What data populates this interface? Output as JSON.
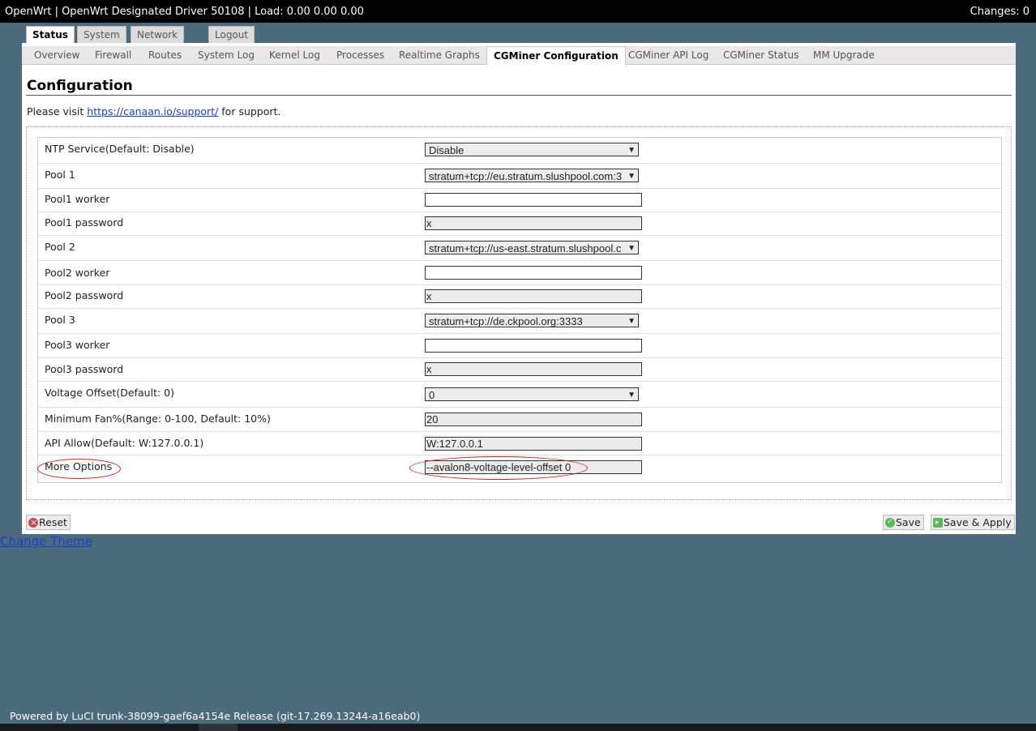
{
  "topbar": {
    "title": "OpenWrt | OpenWrt Designated Driver 50108 | Load: 0.00 0.00 0.00",
    "changes": "Changes: 0"
  },
  "main_tabs": [
    "Status",
    "System",
    "Network",
    "Logout"
  ],
  "sub_tabs": [
    "Overview",
    "Firewall",
    "Routes",
    "System Log",
    "Kernel Log",
    "Processes",
    "Realtime Graphs",
    "CGMiner Configuration",
    "CGMiner API Log",
    "CGMiner Status",
    "MM Upgrade"
  ],
  "page": {
    "heading": "Configuration",
    "visit_prefix": "Please visit",
    "visit_link": "https://canaan.io/support/",
    "visit_suffix": "for support."
  },
  "form": {
    "ntp": {
      "label": "NTP Service(Default: Disable)",
      "value": "Disable"
    },
    "pool1": {
      "label": "Pool 1",
      "value": "stratum+tcp://eu.stratum.slushpool.com:3"
    },
    "pool1_worker": {
      "label": "Pool1 worker",
      "value": ""
    },
    "pool1_password": {
      "label": "Pool1 password",
      "value": "x"
    },
    "pool2": {
      "label": "Pool 2",
      "value": "stratum+tcp://us-east.stratum.slushpool.c"
    },
    "pool2_worker": {
      "label": "Pool2 worker",
      "value": ""
    },
    "pool2_password": {
      "label": "Pool2 password",
      "value": "x"
    },
    "pool3": {
      "label": "Pool 3",
      "value": "stratum+tcp://de.ckpool.org:3333"
    },
    "pool3_worker": {
      "label": "Pool3 worker",
      "value": ""
    },
    "pool3_password": {
      "label": "Pool3 password",
      "value": "x"
    },
    "voltage": {
      "label": "Voltage Offset(Default: 0)",
      "value": "0"
    },
    "min_fan": {
      "label": "Minimum Fan%(Range: 0-100, Default: 10%)",
      "value": "20"
    },
    "api_allow": {
      "label": "API Allow(Default: W:127.0.0.1)",
      "value": "W:127.0.0.1"
    },
    "more_options": {
      "label": "More Options",
      "value": "--avalon8-voltage-level-offset 0"
    }
  },
  "buttons": {
    "reset": "Reset",
    "save": "Save",
    "save_apply": "Save & Apply"
  },
  "change_theme": "Change Theme",
  "footer": "Powered by LuCI trunk-38099-gaef6a4154e Release (git-17.269.13244-a16eab0)",
  "colors": {
    "background": "#4b6a7c",
    "highlight_oval": "#d21c1c",
    "link": "#1a3fcc"
  }
}
